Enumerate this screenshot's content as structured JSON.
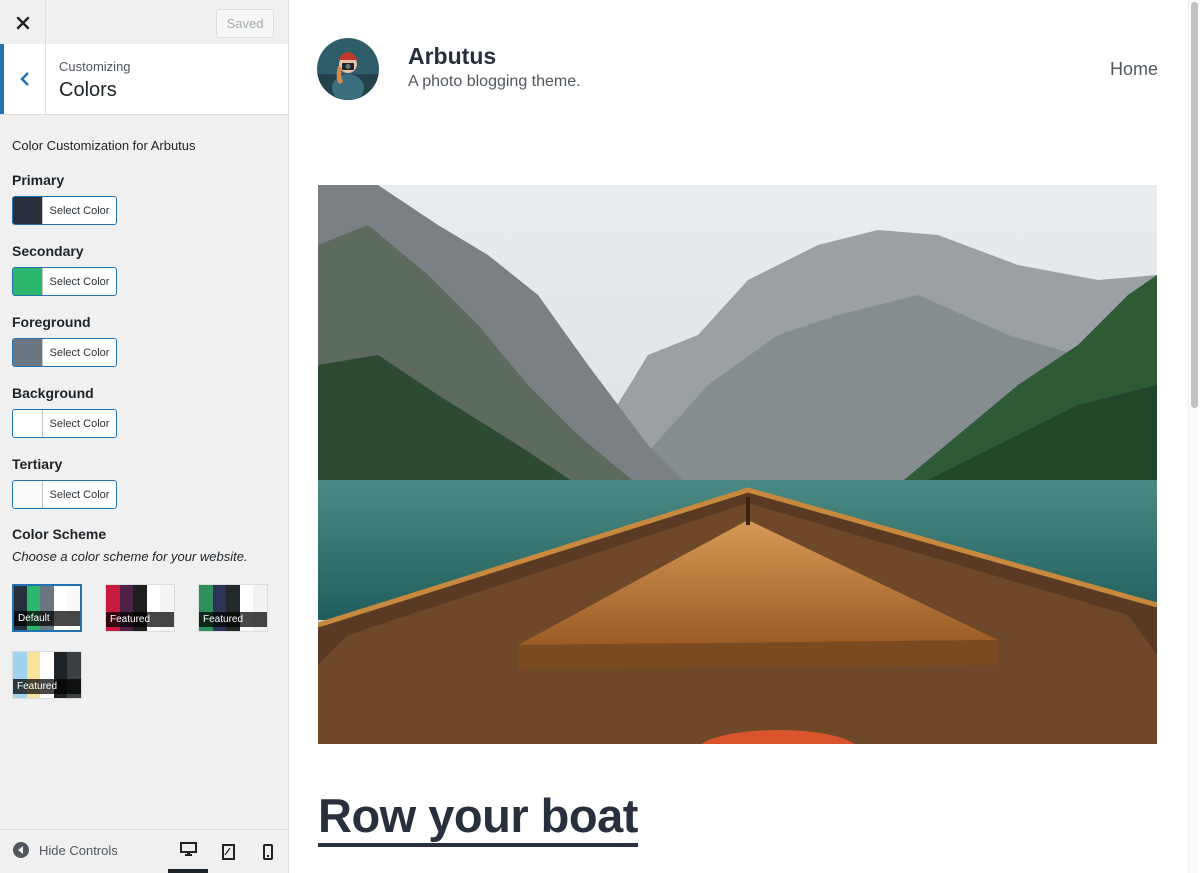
{
  "topbar": {
    "close_icon": "close-icon",
    "saved_label": "Saved"
  },
  "section": {
    "crumb": "Customizing",
    "title": "Colors",
    "back_icon": "chevron-left-icon"
  },
  "controls": {
    "description": "Color Customization for Arbutus",
    "button_label": "Select Color",
    "items": [
      {
        "label": "Primary",
        "color": "#28303d"
      },
      {
        "label": "Secondary",
        "color": "#2cb56d"
      },
      {
        "label": "Foreground",
        "color": "#6b7682"
      },
      {
        "label": "Background",
        "color": "#ffffff"
      },
      {
        "label": "Tertiary",
        "color": "#fafafa"
      }
    ]
  },
  "scheme": {
    "label": "Color Scheme",
    "description": "Choose a color scheme for your website.",
    "options": [
      {
        "name": "Default",
        "selected": true,
        "colors": [
          "#28303d",
          "#2cb56d",
          "#6b7682",
          "#ffffff",
          "#fafafa"
        ]
      },
      {
        "name": "Featured",
        "selected": false,
        "colors": [
          "#c71c3e",
          "#4d2245",
          "#1f1f1f",
          "#ffffff",
          "#f5f5f5"
        ]
      },
      {
        "name": "Featured",
        "selected": false,
        "colors": [
          "#2f8f5b",
          "#2b3356",
          "#23282d",
          "#ffffff",
          "#f2f2f2"
        ]
      },
      {
        "name": "Featured",
        "selected": false,
        "colors": [
          "#9fd3ee",
          "#f8e39a",
          "#ffffff",
          "#1d2327",
          "#3c4043"
        ]
      }
    ]
  },
  "footer": {
    "hide_label": "Hide Controls",
    "devices": [
      "desktop-icon",
      "tablet-icon",
      "mobile-icon"
    ]
  },
  "preview": {
    "site_title": "Arbutus",
    "site_description": "A photo blogging theme.",
    "nav_home": "Home",
    "post_title": "Row your boat"
  }
}
